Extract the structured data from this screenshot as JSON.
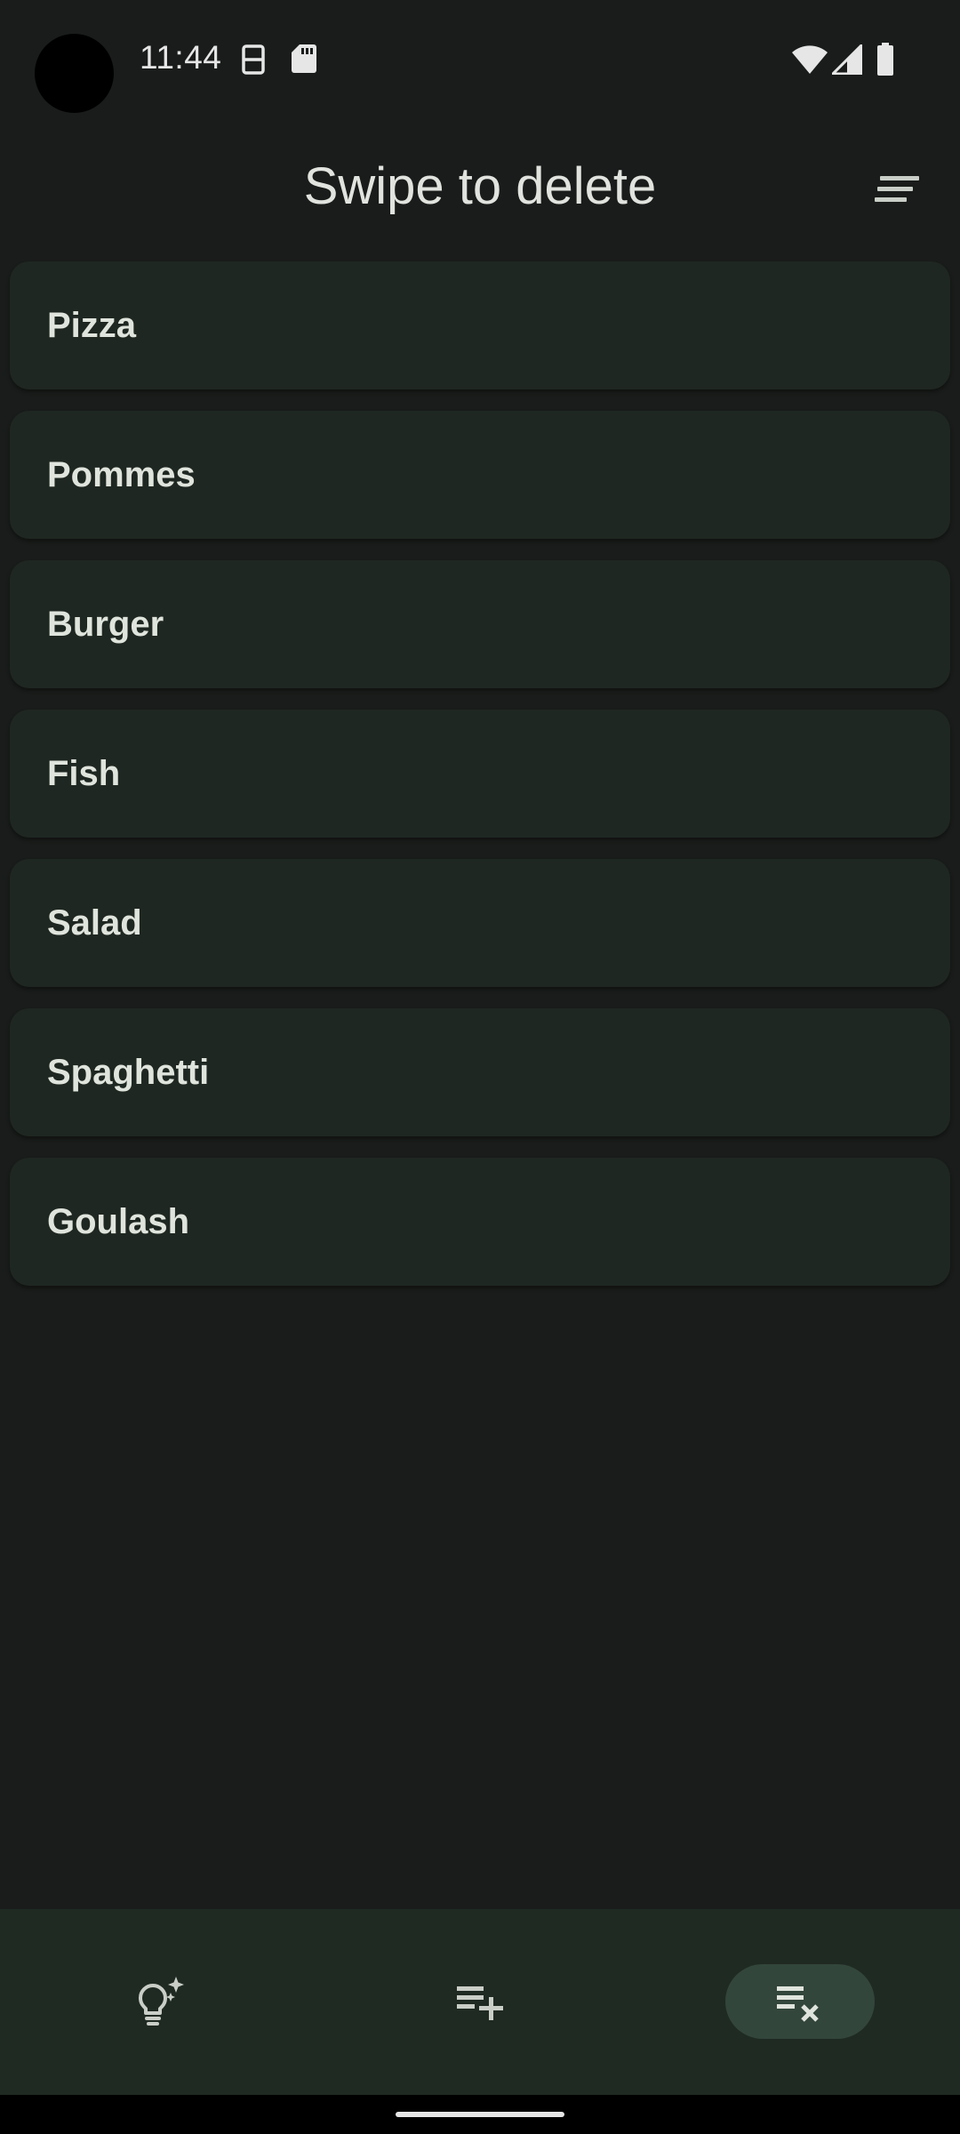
{
  "status_bar": {
    "time": "11:44",
    "icons": [
      "sim-manager-icon",
      "sd-card-icon",
      "wifi-icon",
      "cellular-signal-icon",
      "battery-icon"
    ]
  },
  "app_bar": {
    "title": "Swipe to delete",
    "action_icon": "sort-icon"
  },
  "list": {
    "items": [
      {
        "label": "Pizza"
      },
      {
        "label": "Pommes"
      },
      {
        "label": "Burger"
      },
      {
        "label": "Fish"
      },
      {
        "label": "Salad"
      },
      {
        "label": "Spaghetti"
      },
      {
        "label": "Goulash"
      }
    ]
  },
  "bottom_nav": {
    "items": [
      {
        "icon": "lightbulb-sparkle-icon",
        "selected": false
      },
      {
        "icon": "playlist-add-icon",
        "selected": false
      },
      {
        "icon": "playlist-remove-icon",
        "selected": true
      }
    ]
  },
  "colors": {
    "background": "#191c1a",
    "list_item": "#1f2722",
    "bottom_nav": "#1f2a23",
    "nav_active_indicator": "#33463c",
    "text": "#e1e3df"
  }
}
